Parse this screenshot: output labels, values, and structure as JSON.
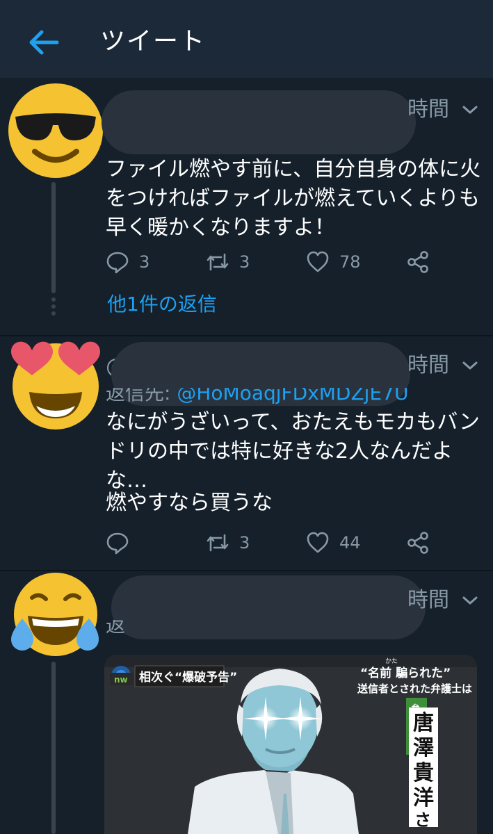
{
  "header": {
    "title": "ツイート"
  },
  "tweets": [
    {
      "time": "時間",
      "lines": [
        "ファイル燃やす前に、自分自身の体に火",
        "をつければファイルが燃えていくよりも",
        "早く暖かくなりますよ！"
      ],
      "reply_count": "3",
      "retweet_count": "3",
      "like_count": "78",
      "more_replies": "他1件の返信"
    },
    {
      "name_prefix": "@",
      "time": "時間",
      "reply_prefix": "返信先: ",
      "reply_handle": "@HoMoaqjFDxMDZjE7U",
      "lines": [
        "なにがうざいって、おたえもモカもバン",
        "ドリの中では特に好きな2人なんだよ",
        "な…",
        "燃やすなら買うな"
      ],
      "reply_count": "",
      "retweet_count": "3",
      "like_count": "44"
    },
    {
      "time": "時間",
      "reply_prefix": "返",
      "image": {
        "logo": "nw",
        "banner": "相次ぐ“爆破予告”",
        "headline1": "“名前 騙られた”",
        "headline1_ruby": "かた",
        "headline2": "送信者とされた弁護士は",
        "title_tag": "弁護士",
        "person_name": "唐澤貴洋さん"
      }
    }
  ],
  "colors": {
    "background": "#15202b",
    "header": "#1c2938",
    "accent": "#1da1f2",
    "secondary_text": "#8899a6"
  },
  "icons": [
    "back-arrow-icon",
    "chevron-down-icon",
    "reply-icon",
    "retweet-icon",
    "heart-icon",
    "share-icon",
    "sunglasses-emoji-avatar",
    "heart-eyes-emoji-avatar",
    "tears-of-joy-emoji-avatar"
  ]
}
